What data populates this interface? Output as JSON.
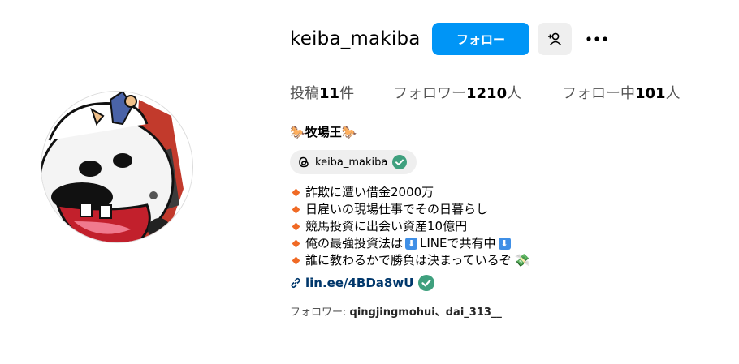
{
  "profile": {
    "username": "keiba_makiba",
    "follow_label": "フォロー",
    "stats": {
      "posts_prefix": "投稿",
      "posts_count": "11",
      "posts_suffix": "件",
      "followers_prefix": "フォロワー",
      "followers_count": "1210",
      "followers_suffix": "人",
      "following_prefix": "フォロー中",
      "following_count": "101",
      "following_suffix": "人"
    },
    "display_name_emoji": "🐎",
    "display_name": "牧場王",
    "threads_handle": "keiba_makiba",
    "bio": [
      {
        "text": "詐欺に遭い借金2000万"
      },
      {
        "text": "日雇いの現場仕事でその日暮らし"
      },
      {
        "text": "競馬投資に出会い資産10億円"
      },
      {
        "text_a": "俺の最強投資法は",
        "text_b": "LINEで共有中"
      },
      {
        "text": "誰に教わるかで勝負は決まっているぞ",
        "emoji": "💸"
      }
    ],
    "link": "lin.ee/4BDa8wU",
    "followed_by_prefix": "フォロワー: ",
    "followed_by": "qingjingmohui、dai_313__"
  },
  "colors": {
    "accent": "#0095f6",
    "link": "#00376b",
    "verified": "#3fa07e",
    "bullet": "#f06a25"
  },
  "icons": [
    "add-person-icon",
    "more-options-icon",
    "threads-icon",
    "verified-check-icon",
    "link-icon",
    "down-arrow-icon"
  ]
}
